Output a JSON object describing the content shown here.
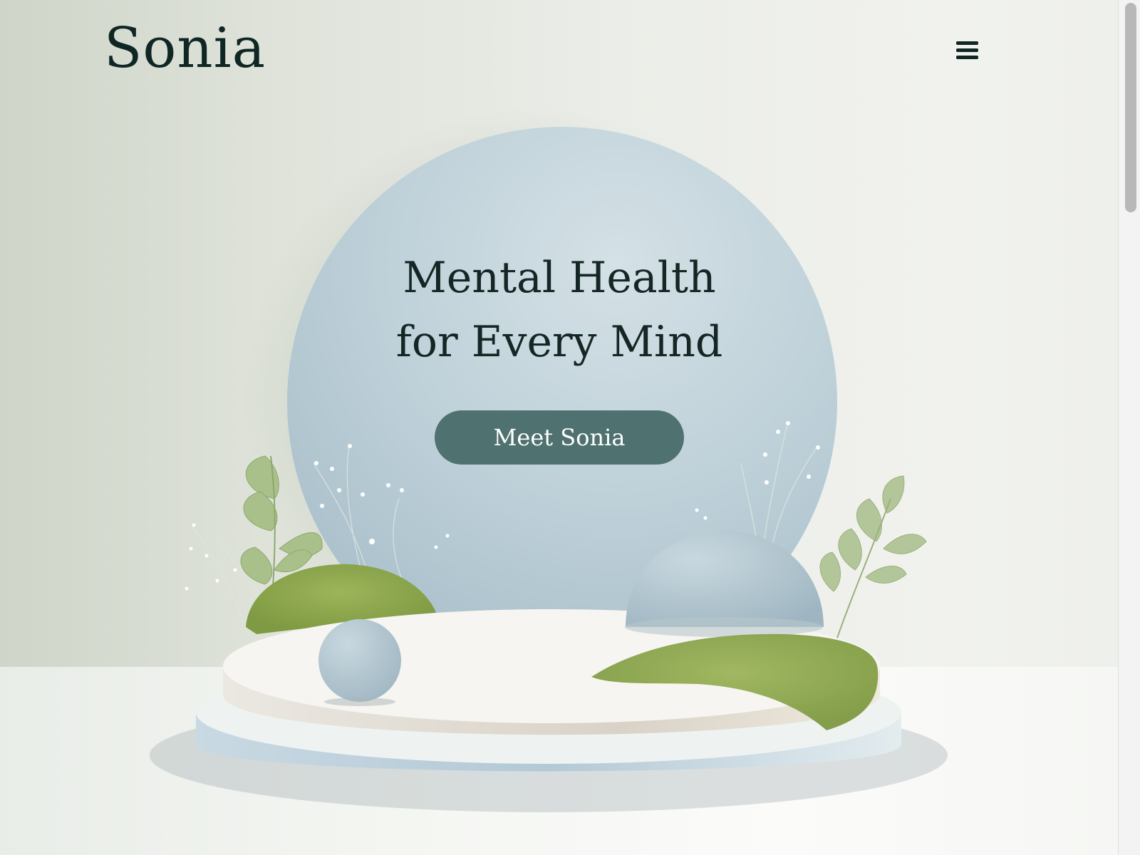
{
  "header": {
    "logo": "Sonia",
    "menu_icon": "hamburger-menu-icon"
  },
  "hero": {
    "headline_line1": "Mental Health",
    "headline_line2": "for Every Mind",
    "cta_label": "Meet Sonia"
  },
  "colors": {
    "text_dark": "#142725",
    "button_bg": "#4f7270",
    "circle_blue": "#b6cad4",
    "moss_green": "#8fa84f"
  }
}
